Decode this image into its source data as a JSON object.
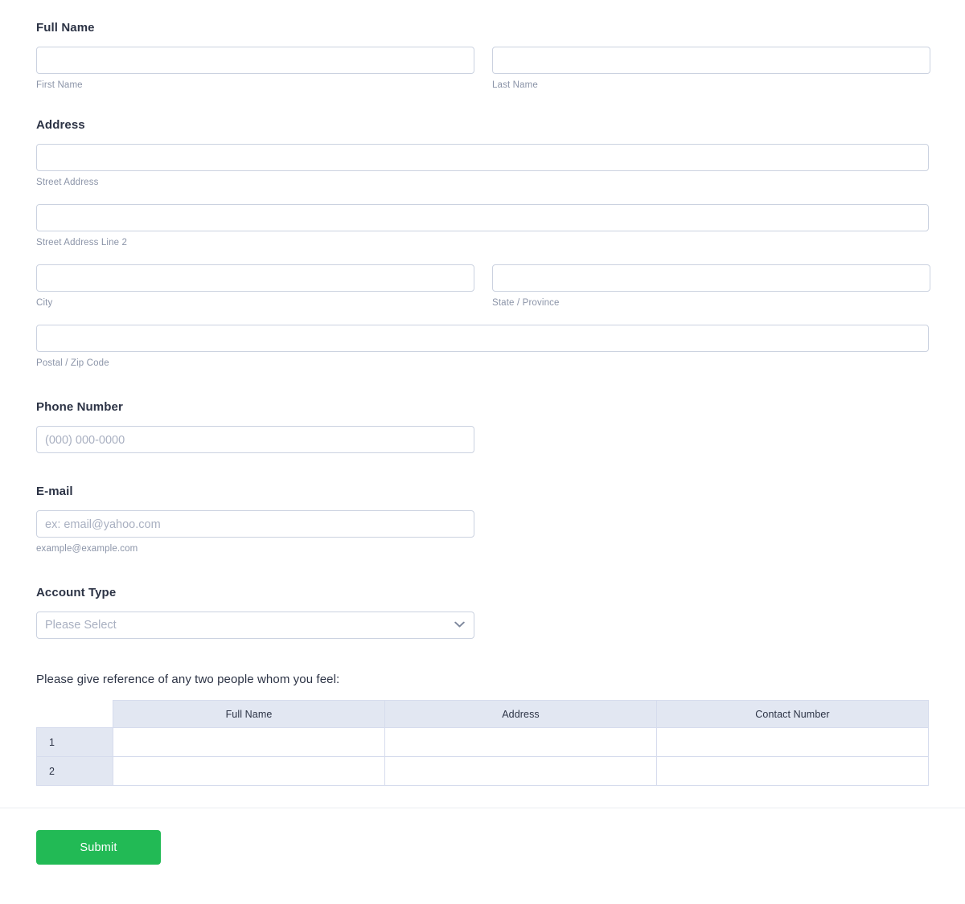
{
  "theme": {
    "accent_green": "#22ba55",
    "heading_color": "#2c3345",
    "sublabel_color": "#8b94a8",
    "input_border": "#cbd2e0",
    "table_header_bg": "#e2e7f2"
  },
  "fields": {
    "full_name": {
      "label": "Full Name",
      "first": {
        "value": "",
        "placeholder": "",
        "sub_label": "First Name"
      },
      "last": {
        "value": "",
        "placeholder": "",
        "sub_label": "Last Name"
      }
    },
    "address": {
      "label": "Address",
      "street": {
        "value": "",
        "placeholder": "",
        "sub_label": "Street Address"
      },
      "street2": {
        "value": "",
        "placeholder": "",
        "sub_label": "Street Address Line 2"
      },
      "city": {
        "value": "",
        "placeholder": "",
        "sub_label": "City"
      },
      "state": {
        "value": "",
        "placeholder": "",
        "sub_label": "State / Province"
      },
      "postal": {
        "value": "",
        "placeholder": "",
        "sub_label": "Postal / Zip Code"
      }
    },
    "phone": {
      "label": "Phone Number",
      "value": "",
      "placeholder": "(000) 000-0000"
    },
    "email": {
      "label": "E-mail",
      "value": "",
      "placeholder": "ex: email@yahoo.com",
      "sub_label": "example@example.com"
    },
    "account_type": {
      "label": "Account Type",
      "selected": "Please Select",
      "icon": "chevron-down-icon"
    }
  },
  "reference_table": {
    "heading": "Please give reference of any two people whom you feel:",
    "columns": [
      "Full Name",
      "Address",
      "Contact Number"
    ],
    "rows": [
      {
        "number": "1",
        "full_name": "",
        "address": "",
        "contact_number": ""
      },
      {
        "number": "2",
        "full_name": "",
        "address": "",
        "contact_number": ""
      }
    ]
  },
  "footer": {
    "submit_label": "Submit"
  }
}
